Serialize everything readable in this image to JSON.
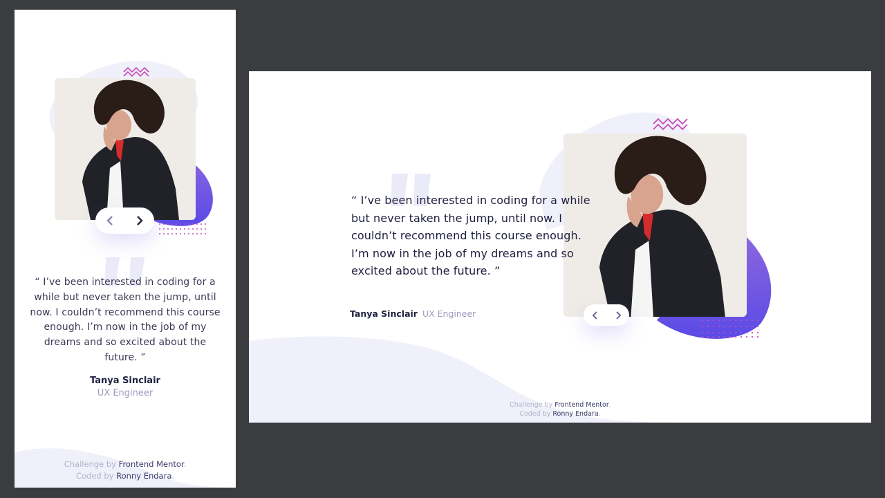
{
  "testimonial": {
    "quote": "“ I’ve been interested in coding for a while but never taken the jump, until now. I couldn’t recommend this course enough. I’m now in the job of my dreams and so excited about the future. ”",
    "name": "Tanya Sinclair",
    "role": "UX Engineer",
    "photo": "woman-portrait-photo"
  },
  "navigation": {
    "prev_icon": "chevron-left-icon",
    "next_icon": "chevron-right-icon"
  },
  "attribution": {
    "challenge_prefix": "Challenge by",
    "challenge_link": "Frontend Mentor",
    "coded_prefix": "Coded by",
    "coded_link": "Ronny Endara",
    "period": "."
  },
  "colors": {
    "page_bg": "#3b3c3f",
    "card_bg": "#ffffff",
    "text_dark": "#202141",
    "text_muted": "#9d9bc0",
    "accent_purple": "#6b54e5",
    "wave_light": "#f0f0fb",
    "zigzag_pink": "#c54bb5"
  }
}
